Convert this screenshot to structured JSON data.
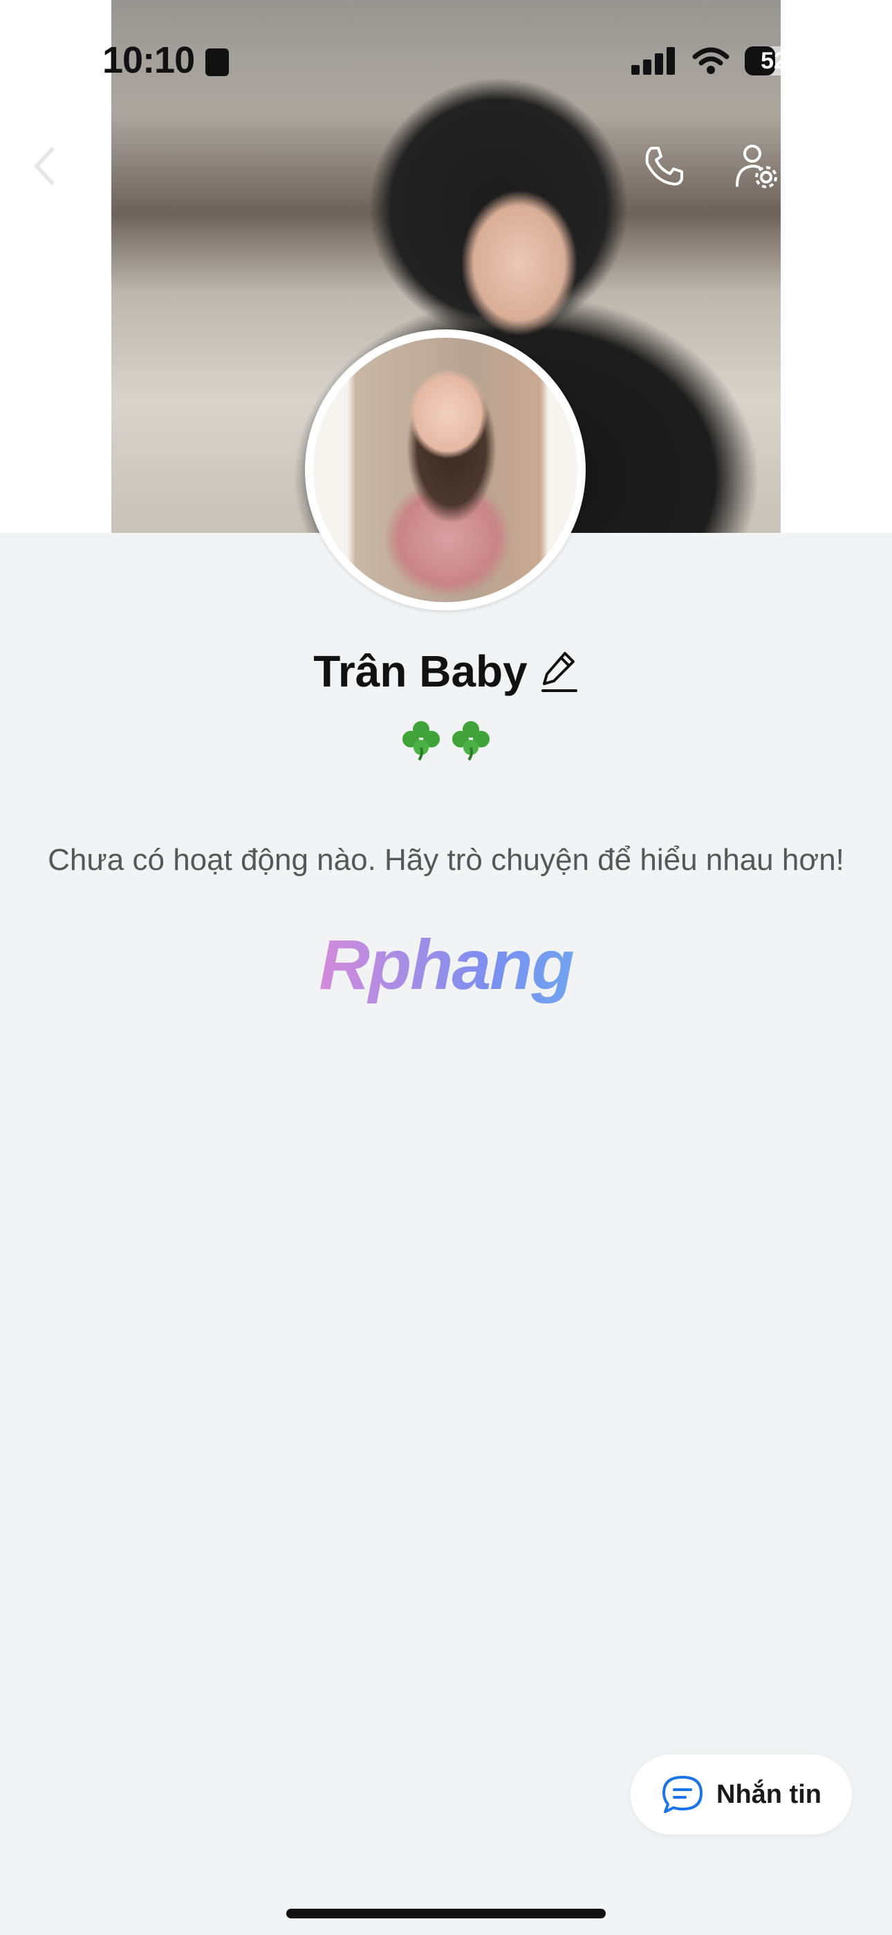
{
  "status_bar": {
    "time": "10:10",
    "battery": "52",
    "battery_level": 0.52
  },
  "nav": {
    "back_icon": "chevron-left-icon",
    "call_icon": "phone-icon",
    "settings_icon": "user-settings-icon",
    "more_icon": "more-dots-icon"
  },
  "profile": {
    "name": "Trân Baby",
    "edit_icon": "pencil-icon",
    "status_emoji_1": "🍀",
    "status_emoji_2": "🍀"
  },
  "activity": {
    "empty_message": "Chưa có hoạt động nào. Hãy trò chuyện để hiểu nhau hơn!"
  },
  "watermark": {
    "text": "Rphang"
  },
  "message_button": {
    "label": "Nhắn tin",
    "icon": "chat-bubble-icon"
  },
  "colors": {
    "background": "#f2f3f5",
    "accent": "#1a73e8"
  }
}
